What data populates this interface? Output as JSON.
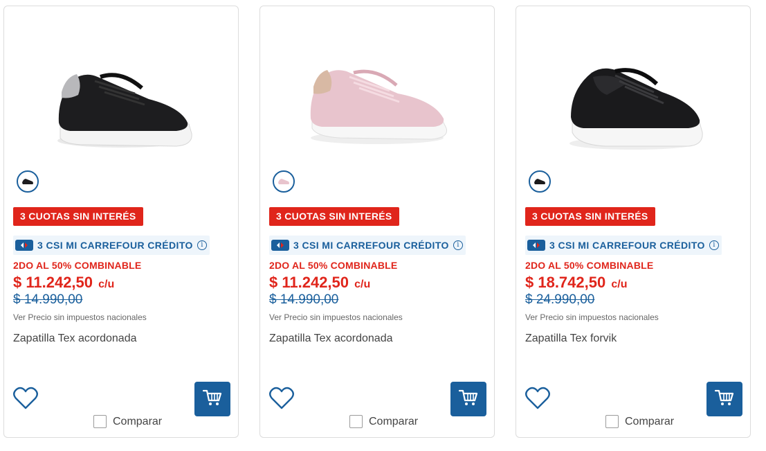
{
  "products": [
    {
      "badge_cuotas": "3 CUOTAS SIN INTERÉS",
      "badge_csi": "3 CSI MI CARREFOUR CRÉDITO",
      "promo": "2DO AL 50% COMBINABLE",
      "price": "$ 11.242,50",
      "price_unit": "c/u",
      "old_price": "$ 14.990,00",
      "tax_note": "Ver Precio sin impuestos nacionales",
      "name": "Zapatilla Tex acordonada",
      "compare_label": "Comparar",
      "shoe_color": "#1d1d1f",
      "accent_color": "#b8b8bb"
    },
    {
      "badge_cuotas": "3 CUOTAS SIN INTERÉS",
      "badge_csi": "3 CSI MI CARREFOUR CRÉDITO",
      "promo": "2DO AL 50% COMBINABLE",
      "price": "$ 11.242,50",
      "price_unit": "c/u",
      "old_price": "$ 14.990,00",
      "tax_note": "Ver Precio sin impuestos nacionales",
      "name": "Zapatilla Tex acordonada",
      "compare_label": "Comparar",
      "shoe_color": "#e8c4cd",
      "accent_color": "#d8b9a4"
    },
    {
      "badge_cuotas": "3 CUOTAS SIN INTERÉS",
      "badge_csi": "3 CSI MI CARREFOUR CRÉDITO",
      "promo": "2DO AL 50% COMBINABLE",
      "price": "$ 18.742,50",
      "price_unit": "c/u",
      "old_price": "$ 24.990,00",
      "tax_note": "Ver Precio sin impuestos nacionales",
      "name": "Zapatilla Tex forvik",
      "compare_label": "Comparar",
      "shoe_color": "#1a1a1c",
      "accent_color": "#2b2b2e"
    }
  ],
  "colors": {
    "brand_blue": "#1a5f9c",
    "promo_red": "#e0251b"
  },
  "icons": {
    "favorite": "heart-icon",
    "cart": "cart-icon",
    "info": "info-icon",
    "carrefour": "carrefour-logo-icon"
  }
}
